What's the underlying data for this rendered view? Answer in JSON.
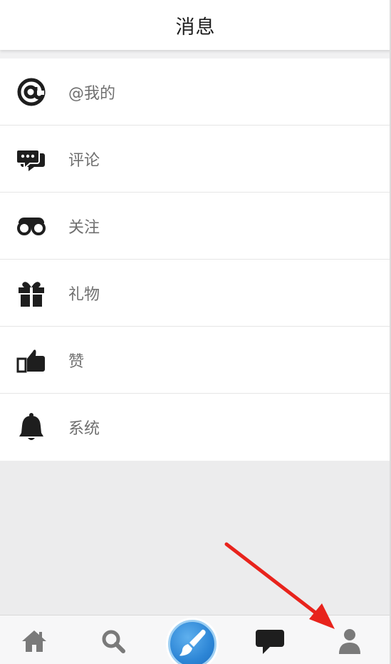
{
  "header": {
    "title": "消息"
  },
  "list": {
    "items": [
      {
        "label": "@我的",
        "icon": "at-icon"
      },
      {
        "label": "评论",
        "icon": "comment-icon"
      },
      {
        "label": "关注",
        "icon": "binoculars-icon"
      },
      {
        "label": "礼物",
        "icon": "gift-icon"
      },
      {
        "label": "赞",
        "icon": "thumbs-up-icon"
      },
      {
        "label": "系统",
        "icon": "bell-icon"
      }
    ]
  },
  "tabbar": {
    "tabs": [
      {
        "icon": "home-icon"
      },
      {
        "icon": "search-icon"
      },
      {
        "icon": "brush-icon"
      },
      {
        "icon": "chat-bubble-icon"
      },
      {
        "icon": "user-icon"
      }
    ]
  },
  "colors": {
    "header_bg": "#ffffff",
    "page_bg": "#ececed",
    "label_text": "#6f6f6f",
    "icon_dark": "#1e1e1e",
    "tab_icon": "#7a7a7a",
    "center_button": "#2d86d6",
    "annotation_arrow": "#e8231c"
  }
}
